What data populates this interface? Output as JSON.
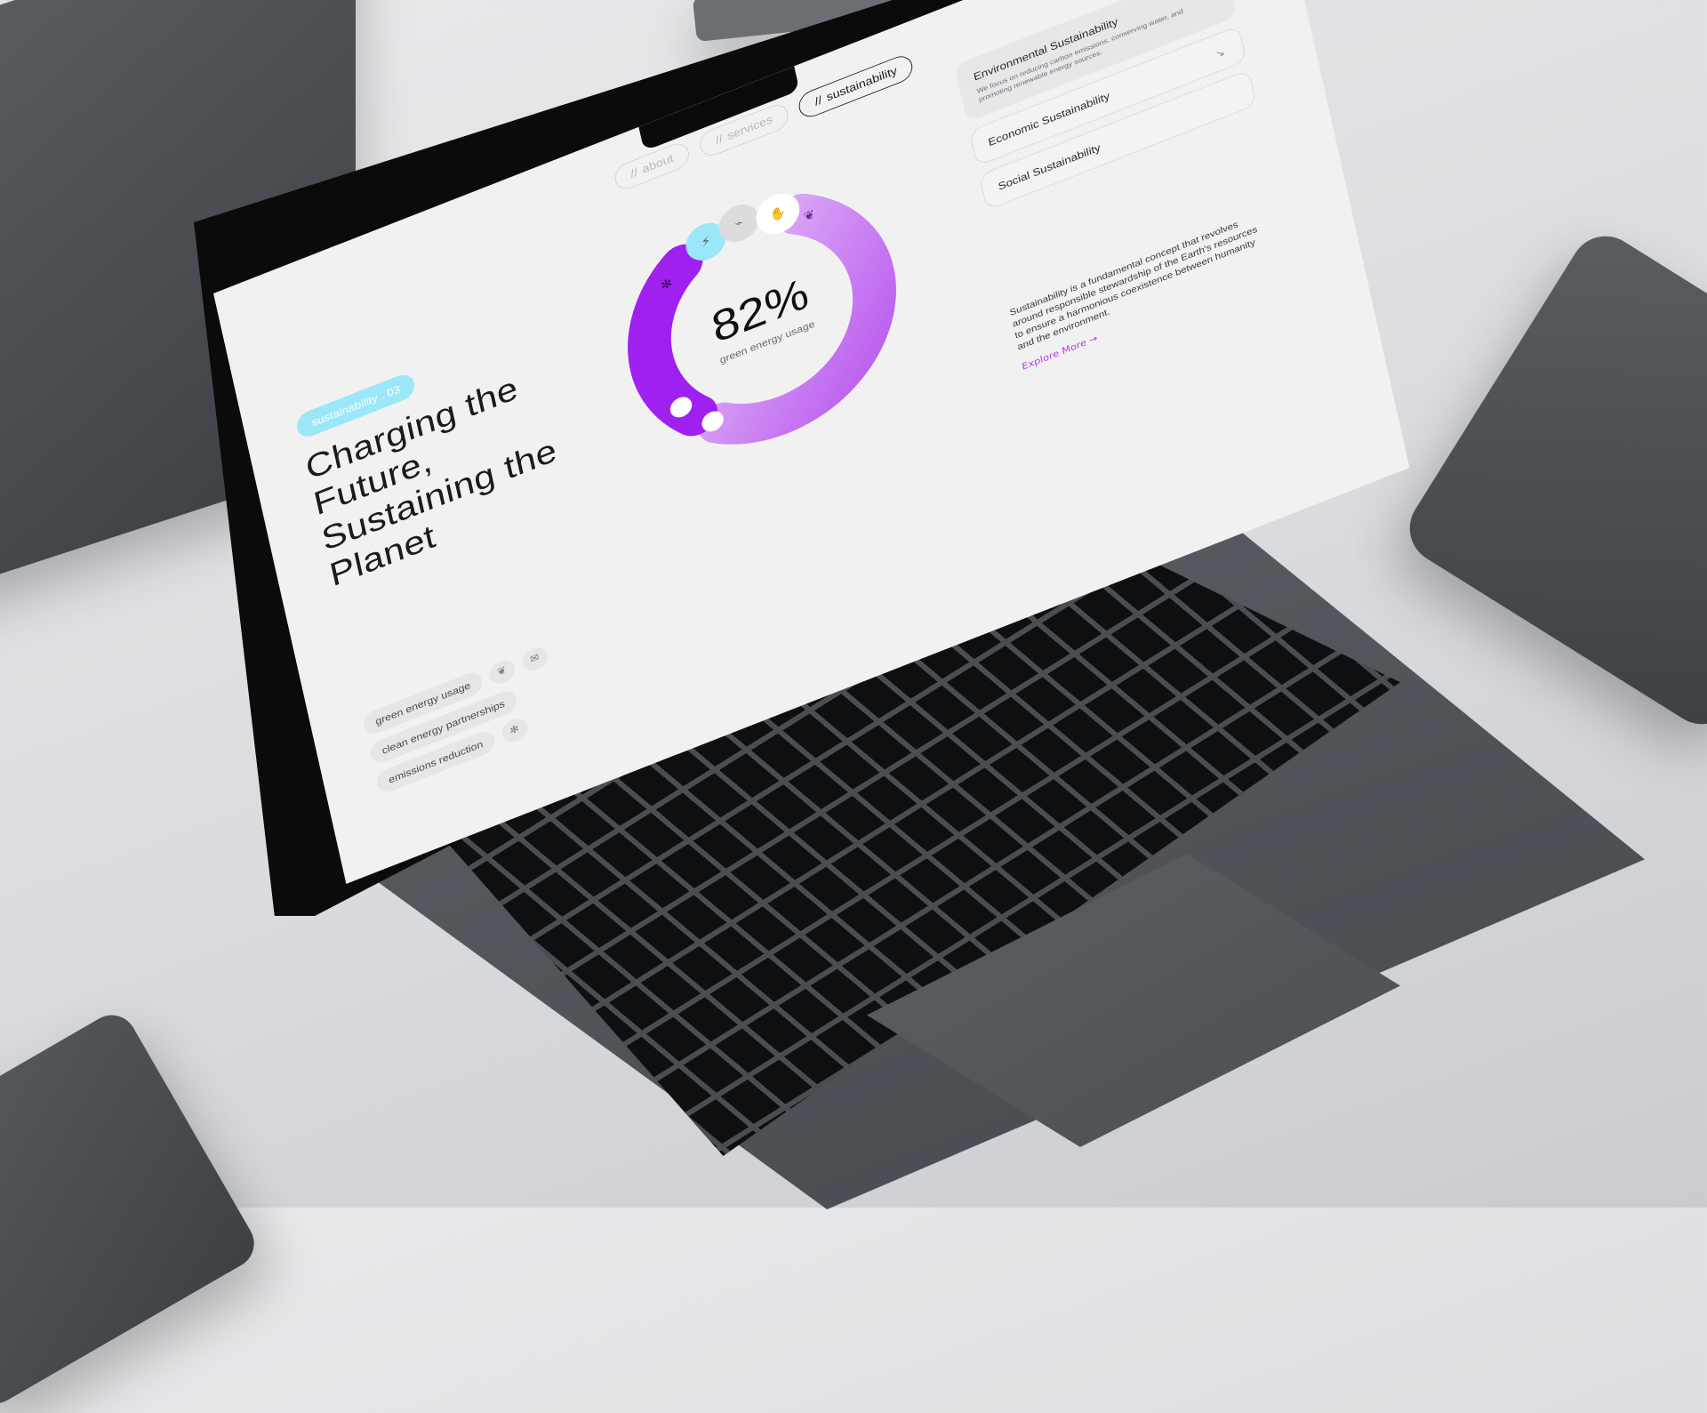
{
  "nav": {
    "items": [
      {
        "hash": "//",
        "label": "about"
      },
      {
        "hash": "//",
        "label": "services"
      },
      {
        "hash": "//",
        "label": "sustainability"
      }
    ]
  },
  "hero": {
    "badge": "sustainability . 03",
    "headline": "Charging the Future, Sustaining the Planet"
  },
  "gauge": {
    "value": "82%",
    "caption": "green energy usage",
    "fraction": 0.82,
    "colors": {
      "primary": "#a020f0",
      "secondary": "#d9a3f5",
      "accent": "#9ae8f7"
    },
    "segment_icons": [
      "leaf-icon",
      "hand-coin-icon",
      "plug-icon",
      "charging-station-icon",
      "wind-turbine-icon"
    ]
  },
  "accordion": {
    "items": [
      {
        "title": "Environmental Sustainability",
        "desc": "We focus on reducing carbon emissions, conserving water, and promoting renewable energy sources.",
        "arrow": "↗"
      },
      {
        "title": "Economic Sustainability",
        "arrow": "↘"
      },
      {
        "title": "Social Sustainability",
        "arrow": "↘"
      }
    ]
  },
  "about": {
    "text": "Sustainability is a fundamental concept that revolves around responsible stewardship of the Earth's resources to ensure a harmonious coexistence between humanity and the environment.",
    "link": "Explore More",
    "link_arrow": "→"
  },
  "tags": [
    {
      "label": "green energy usage",
      "icon": "leaf-icon",
      "glyph": "❦"
    },
    {
      "label": "clean energy partnerships",
      "icon": "mail-icon",
      "glyph": "✉"
    },
    {
      "label": "emissions reduction",
      "icon": "wind-turbine-icon",
      "glyph": "✻"
    }
  ],
  "colors": {
    "accent_purple": "#b43cf0",
    "badge_cyan": "#9ae8f7"
  }
}
